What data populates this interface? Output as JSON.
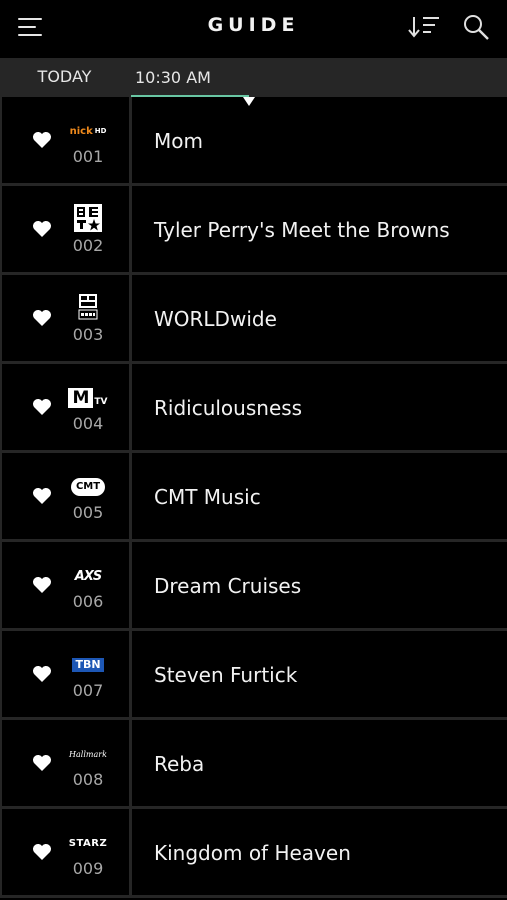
{
  "header": {
    "title": "GUIDE",
    "icons": [
      "menu-icon",
      "sort-icon",
      "search-icon"
    ]
  },
  "timebar": {
    "day": "TODAY",
    "time_slot": "10:30 AM",
    "accent_color": "#69c7a4"
  },
  "logo_text": {
    "nick": "nick",
    "nick_hd": "HD",
    "mtv": "M",
    "mtv_tv": "TV",
    "cmt": "CMT",
    "axs": "AXS",
    "tbn": "TBN",
    "hallmark": "Hallmark",
    "starz": "STARZ"
  },
  "channels": [
    {
      "number": "001",
      "logo": "nick-hd-logo",
      "program": "Mom"
    },
    {
      "number": "002",
      "logo": "bet-logo",
      "program": "Tyler Perry's Meet the Browns"
    },
    {
      "number": "003",
      "logo": "bet-soul-logo",
      "program": "WORLDwide"
    },
    {
      "number": "004",
      "logo": "mtv-logo",
      "program": "Ridiculousness"
    },
    {
      "number": "005",
      "logo": "cmt-logo",
      "program": "CMT Music"
    },
    {
      "number": "006",
      "logo": "axs-logo",
      "program": "Dream Cruises"
    },
    {
      "number": "007",
      "logo": "tbn-logo",
      "program": "Steven Furtick"
    },
    {
      "number": "008",
      "logo": "hallmark-logo",
      "program": "Reba"
    },
    {
      "number": "009",
      "logo": "starz-logo",
      "program": "Kingdom of Heaven"
    }
  ]
}
